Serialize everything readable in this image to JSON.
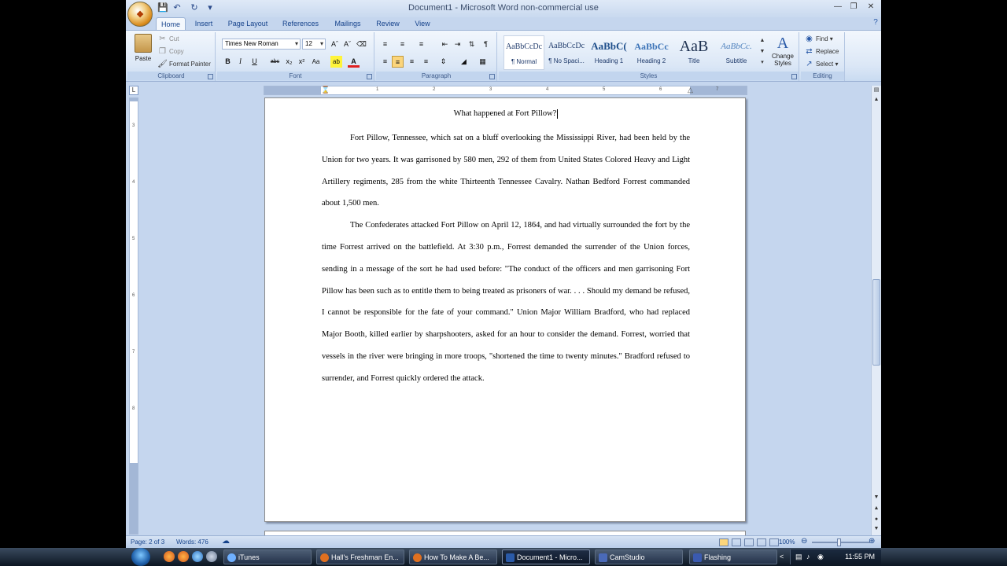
{
  "window": {
    "title": "Document1 - Microsoft Word non-commercial use",
    "controls": [
      "minimize",
      "maximize",
      "close"
    ]
  },
  "quick_access": [
    "save-icon",
    "undo-icon",
    "redo-icon",
    "customize-icon"
  ],
  "tabs": [
    "Home",
    "Insert",
    "Page Layout",
    "References",
    "Mailings",
    "Review",
    "View"
  ],
  "ribbon": {
    "clipboard": {
      "label": "Clipboard",
      "paste": "Paste",
      "cut": "Cut",
      "copy": "Copy",
      "format_painter": "Format Painter"
    },
    "font": {
      "label": "Font",
      "font_name": "Times New Roman",
      "font_size": "12",
      "buttons": [
        "B",
        "I",
        "U",
        "abc",
        "x₂",
        "x²",
        "Aa"
      ]
    },
    "paragraph": {
      "label": "Paragraph"
    },
    "styles": {
      "label": "Styles",
      "items": [
        {
          "sample": "AaBbCcDc",
          "name": "¶ Normal"
        },
        {
          "sample": "AaBbCcDc",
          "name": "¶ No Spaci..."
        },
        {
          "sample": "AaBbC(",
          "name": "Heading 1"
        },
        {
          "sample": "AaBbCc",
          "name": "Heading 2"
        },
        {
          "sample": "AaB",
          "name": "Title"
        },
        {
          "sample": "AaBbCc.",
          "name": "Subtitle"
        }
      ],
      "change_styles": "Change Styles"
    },
    "editing": {
      "label": "Editing",
      "find": "Find",
      "replace": "Replace",
      "select": "Select"
    }
  },
  "document": {
    "title": "What happened at Fort Pillow?",
    "paragraphs": [
      "Fort Pillow, Tennessee, which sat on a bluff overlooking the Mississippi River, had been held by the Union for two years. It was garrisoned by 580 men, 292 of them from United States Colored Heavy and Light Artillery regiments, 285 from the white Thirteenth Tennessee Cavalry. Nathan Bedford Forrest commanded about 1,500 men.",
      "The Confederates attacked Fort Pillow on April 12, 1864, and had virtually surrounded the fort by the time Forrest arrived on the battlefield. At 3:30 p.m., Forrest demanded the surrender of the Union forces, sending in a message of the sort he had used before: \"The conduct of the officers and men garrisoning Fort Pillow has been such as to entitle them to being treated as prisoners of war. . . . Should my demand be refused, I cannot be responsible for the fate of your command.\" Union Major William Bradford, who had replaced Major Booth, killed earlier by sharpshooters, asked for an hour to consider the demand. Forrest, worried that vessels in the river were bringing in more troops, \"shortened the time to twenty minutes.\" Bradford refused to surrender, and Forrest quickly ordered the attack."
    ]
  },
  "statusbar": {
    "page": "Page: 2 of 3",
    "words": "Words: 476",
    "zoom": "100%"
  },
  "taskbar": {
    "items": [
      "iTunes",
      "Hall's Freshman En...",
      "How To Make A Be...",
      "Document1 - Micro...",
      "CamStudio",
      "Flashing"
    ],
    "active_index": 3,
    "clock": "11:55 PM"
  }
}
